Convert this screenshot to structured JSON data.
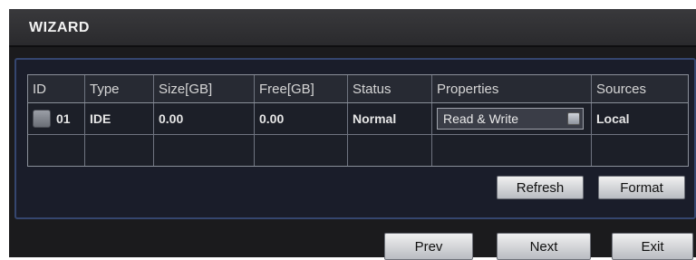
{
  "window": {
    "title": "WIZARD"
  },
  "table": {
    "headers": [
      "ID",
      "Type",
      "Size[GB]",
      "Free[GB]",
      "Status",
      "Properties",
      "Sources"
    ],
    "rows": [
      {
        "id": "01",
        "type": "IDE",
        "size": "0.00",
        "free": "0.00",
        "status": "Normal",
        "properties": "Read & Write",
        "sources": "Local"
      }
    ]
  },
  "actions": {
    "refresh": "Refresh",
    "format": "Format"
  },
  "nav": {
    "prev": "Prev",
    "next": "Next",
    "exit": "Exit"
  }
}
